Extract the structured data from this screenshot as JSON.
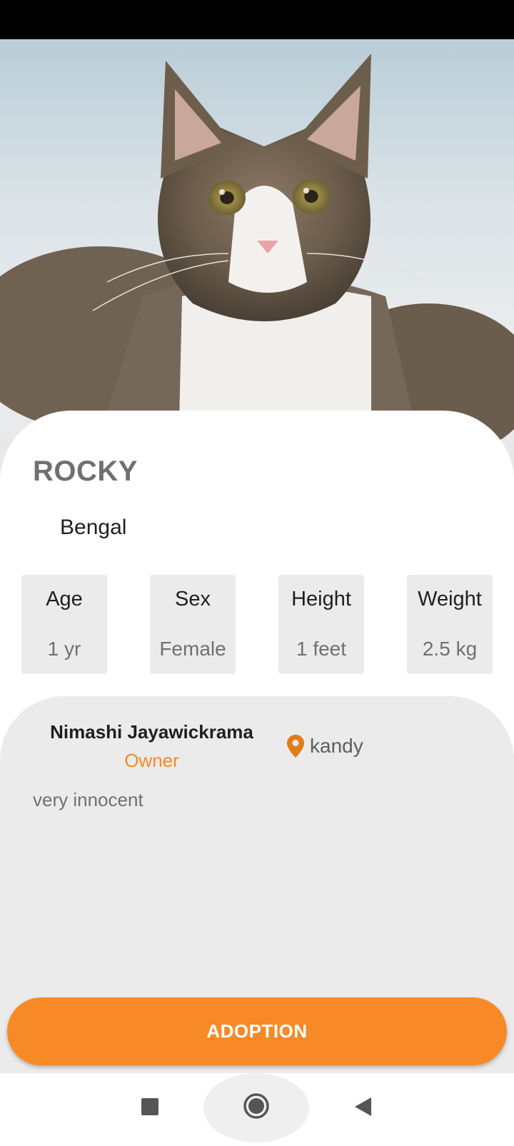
{
  "pet": {
    "name": "ROCKY",
    "breed": "Bengal",
    "photo_icon": "cat-photo"
  },
  "stats": [
    {
      "label": "Age",
      "value": "1 yr"
    },
    {
      "label": "Sex",
      "value": "Female"
    },
    {
      "label": "Height",
      "value": "1 feet"
    },
    {
      "label": "Weight",
      "value": "2.5 kg"
    }
  ],
  "owner": {
    "name": "Nimashi Jayawickrama",
    "role": "Owner",
    "location": "kandy",
    "location_icon": "map-pin-icon"
  },
  "description": "very innocent",
  "action": {
    "adopt_label": "ADOPTION"
  },
  "navigation": {
    "recents_icon": "square-icon",
    "home_icon": "circle-icon",
    "back_icon": "triangle-back-icon"
  },
  "colors": {
    "accent": "#f78a26",
    "owner_role": "#f58b25",
    "panel": "#ebebeb"
  }
}
